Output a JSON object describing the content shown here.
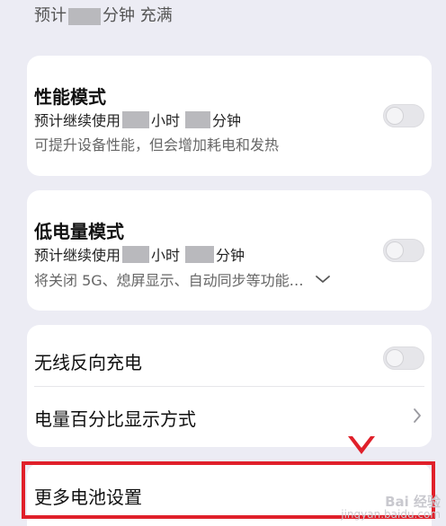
{
  "header": {
    "charge_prefix": "预计",
    "charge_suffix": "分钟 充满"
  },
  "performance_mode": {
    "title": "性能模式",
    "usage_prefix": "预计继续使用",
    "usage_hours": "小时",
    "usage_minutes": "分钟",
    "description": "可提升设备性能，但会增加耗电和发热",
    "enabled": false
  },
  "low_power_mode": {
    "title": "低电量模式",
    "usage_prefix": "预计继续使用",
    "usage_hours": "小时",
    "usage_minutes": "分钟",
    "description": "将关闭 5G、熄屏显示、自动同步等功能…",
    "enabled": false
  },
  "wireless_reverse_charging": {
    "title": "无线反向充电",
    "enabled": false
  },
  "battery_percentage_display": {
    "title": "电量百分比显示方式"
  },
  "more_battery_settings": {
    "title": "更多电池设置"
  },
  "annotation": {
    "color": "#e0202a"
  },
  "watermark": {
    "line1": "Bai 经验",
    "line2": "jingyan.baidu.com"
  }
}
